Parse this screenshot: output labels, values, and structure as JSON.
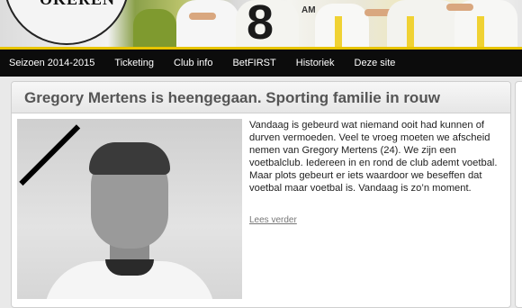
{
  "header": {
    "logo_text": "OKEREN",
    "jersey_number": "8",
    "sponsor_text": "AM"
  },
  "nav": {
    "items": [
      {
        "label": "Seizoen 2014-2015"
      },
      {
        "label": "Ticketing"
      },
      {
        "label": "Club info"
      },
      {
        "label": "BetFIRST"
      },
      {
        "label": "Historiek"
      },
      {
        "label": "Deze site"
      }
    ]
  },
  "article": {
    "title": "Gregory Mertens is heengegaan. Sporting familie in rouw",
    "body": "Vandaag is gebeurd wat niemand ooit had kunnen of durven vermoeden. Veel te vroeg moeten we afscheid nemen van Gregory Mertens (24). We zijn een voetbalclub. Iedereen in en rond de club ademt voetbal. Maar plots gebeurt er iets waardoor we beseffen dat voetbal maar voetbal is. Vandaag is zo’n moment.",
    "read_more": "Lees verder"
  },
  "colors": {
    "accent": "#e8c400",
    "nav_bg": "#0c0c0c"
  }
}
